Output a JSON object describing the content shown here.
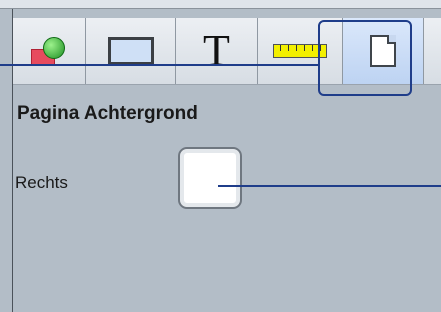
{
  "toolbar": {
    "tabs": [
      {
        "name": "shapes",
        "icon": "shapes-icon"
      },
      {
        "name": "box",
        "icon": "rectangle-icon"
      },
      {
        "name": "text",
        "icon": "text-icon",
        "glyph": "T"
      },
      {
        "name": "ruler",
        "icon": "ruler-icon"
      },
      {
        "name": "page",
        "icon": "page-icon",
        "selected": true
      }
    ]
  },
  "panel": {
    "title": "Pagina Achtergrond",
    "right_label": "Rechts",
    "right_color": "#ffffff"
  },
  "colors": {
    "background": "#b3bdc7",
    "highlight": "#1f3d8a",
    "selected_tab": "#c8daf4"
  }
}
